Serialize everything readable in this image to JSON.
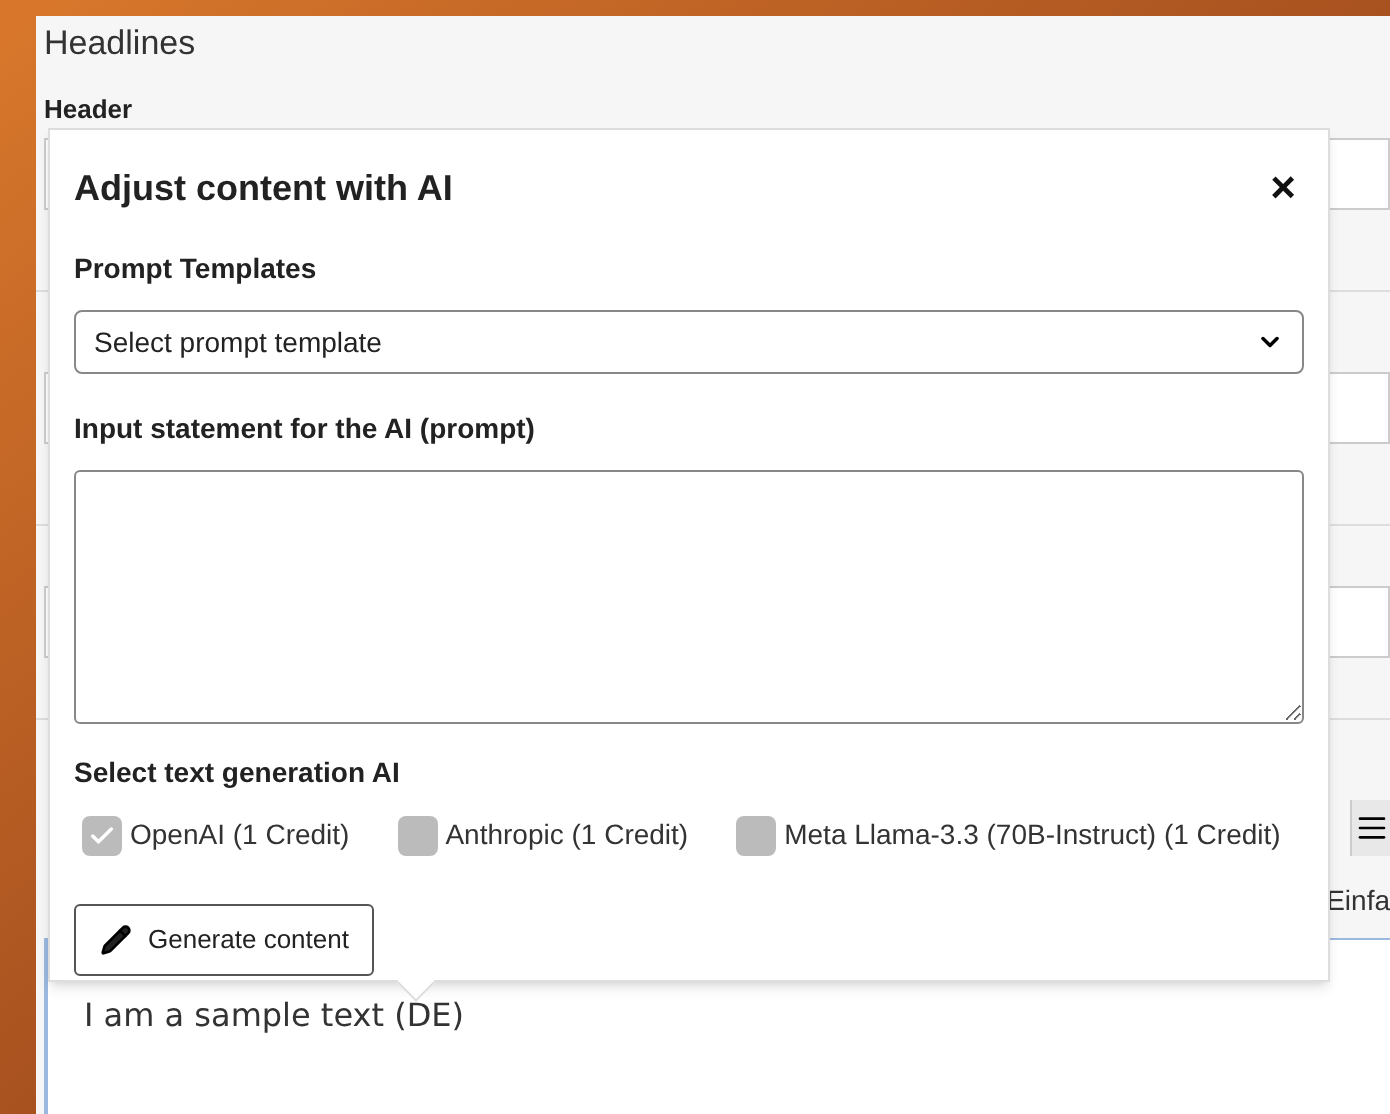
{
  "page": {
    "title": "Headlines",
    "field_label": "Header",
    "editor_text": "I am a sample text (DE)",
    "toolbar_partial_text": "Einfa"
  },
  "dialog": {
    "title": "Adjust content with AI",
    "close": "×",
    "template_label": "Prompt Templates",
    "template_placeholder": "Select prompt template",
    "prompt_label": "Input statement for the AI (prompt)",
    "ai_label": "Select text generation AI",
    "ai_options": [
      {
        "label": "OpenAI (1 Credit)",
        "checked": true
      },
      {
        "label": "Anthropic (1 Credit)",
        "checked": false
      },
      {
        "label": "Meta Llama-3.3 (70B-Instruct) (1 Credit)",
        "checked": false
      }
    ],
    "generate_button": "Generate content"
  }
}
